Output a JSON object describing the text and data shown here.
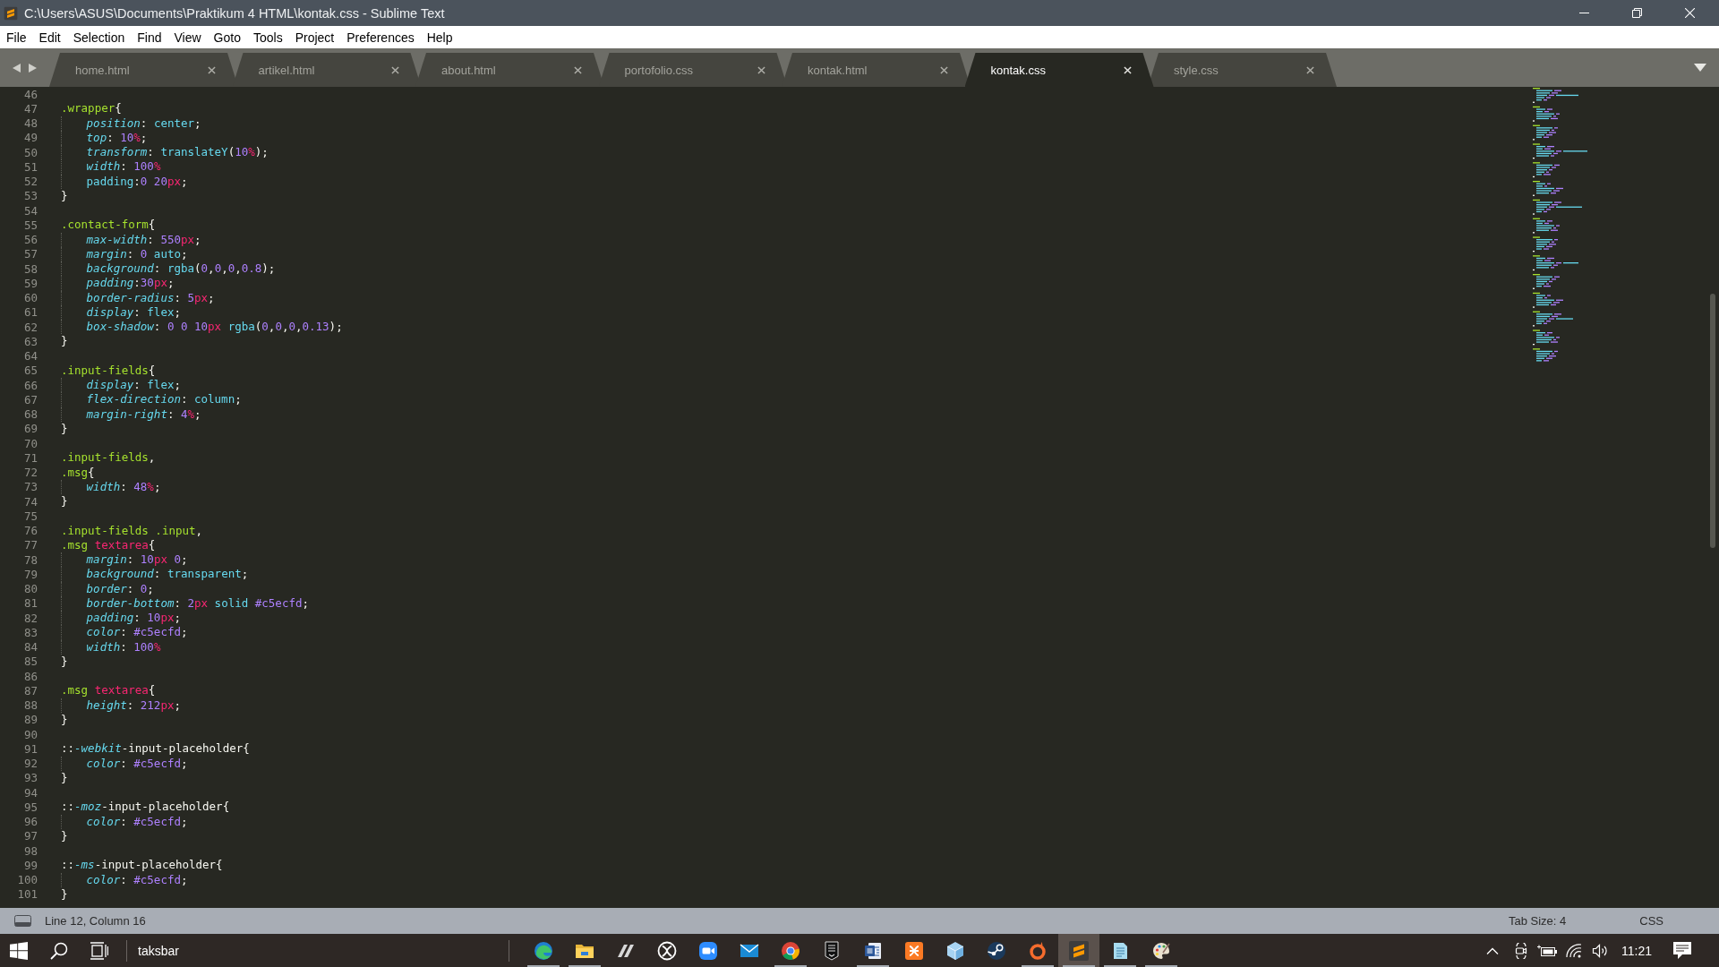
{
  "window": {
    "title": "C:\\Users\\ASUS\\Documents\\Praktikum 4 HTML\\kontak.css - Sublime Text"
  },
  "menu": [
    "File",
    "Edit",
    "Selection",
    "Find",
    "View",
    "Goto",
    "Tools",
    "Project",
    "Preferences",
    "Help"
  ],
  "tabs": [
    {
      "label": "home.html",
      "selected": false
    },
    {
      "label": "artikel.html",
      "selected": false
    },
    {
      "label": "about.html",
      "selected": false
    },
    {
      "label": "portofolio.css",
      "selected": false
    },
    {
      "label": "kontak.html",
      "selected": false
    },
    {
      "label": "kontak.css",
      "selected": true
    },
    {
      "label": "style.css",
      "selected": false
    }
  ],
  "editor": {
    "lines": [
      {
        "number": "46",
        "indented": false
      },
      {
        "number": "47",
        "indented": false,
        "tokens": [
          {
            "text": ".wrapper",
            "kind": "selector"
          },
          {
            "text": "{",
            "kind": "punct"
          }
        ]
      },
      {
        "number": "48",
        "indented": true,
        "tokens": [
          {
            "text": "position",
            "kind": "property"
          },
          {
            "text": ": ",
            "kind": "punct"
          },
          {
            "text": "center",
            "kind": "keyword"
          },
          {
            "text": ";",
            "kind": "punct"
          }
        ]
      },
      {
        "number": "49",
        "indented": true,
        "tokens": [
          {
            "text": "top",
            "kind": "property"
          },
          {
            "text": ": ",
            "kind": "punct"
          },
          {
            "text": "10",
            "kind": "number"
          },
          {
            "text": "%",
            "kind": "unit"
          },
          {
            "text": ";",
            "kind": "punct"
          }
        ]
      },
      {
        "number": "50",
        "indented": true,
        "tokens": [
          {
            "text": "transform",
            "kind": "property"
          },
          {
            "text": ": ",
            "kind": "punct"
          },
          {
            "text": "translateY",
            "kind": "keyword"
          },
          {
            "text": "(",
            "kind": "punct"
          },
          {
            "text": "10",
            "kind": "number"
          },
          {
            "text": "%",
            "kind": "unit"
          },
          {
            "text": ");",
            "kind": "punct"
          }
        ]
      },
      {
        "number": "51",
        "indented": true,
        "tokens": [
          {
            "text": "width",
            "kind": "property"
          },
          {
            "text": ": ",
            "kind": "punct"
          },
          {
            "text": "100",
            "kind": "number"
          },
          {
            "text": "%",
            "kind": "unit"
          }
        ]
      },
      {
        "number": "52",
        "indented": true,
        "tokens": [
          {
            "text": "padding",
            "kind": "keyword"
          },
          {
            "text": ":",
            "kind": "punct"
          },
          {
            "text": "0 20",
            "kind": "number"
          },
          {
            "text": "px",
            "kind": "unit"
          },
          {
            "text": ";",
            "kind": "punct"
          }
        ]
      },
      {
        "number": "53",
        "indented": false,
        "tokens": [
          {
            "text": "}",
            "kind": "punct"
          }
        ]
      },
      {
        "number": "54",
        "indented": false
      },
      {
        "number": "55",
        "indented": false,
        "tokens": [
          {
            "text": ".contact-form",
            "kind": "selector"
          },
          {
            "text": "{",
            "kind": "punct"
          }
        ]
      },
      {
        "number": "56",
        "indented": true,
        "tokens": [
          {
            "text": "max-width",
            "kind": "property"
          },
          {
            "text": ": ",
            "kind": "punct"
          },
          {
            "text": "550",
            "kind": "number"
          },
          {
            "text": "px",
            "kind": "unit"
          },
          {
            "text": ";",
            "kind": "punct"
          }
        ]
      },
      {
        "number": "57",
        "indented": true,
        "tokens": [
          {
            "text": "margin",
            "kind": "property"
          },
          {
            "text": ": ",
            "kind": "punct"
          },
          {
            "text": "0",
            "kind": "number"
          },
          {
            "text": " auto",
            "kind": "keyword"
          },
          {
            "text": ";",
            "kind": "punct"
          }
        ]
      },
      {
        "number": "58",
        "indented": true,
        "tokens": [
          {
            "text": "background",
            "kind": "property"
          },
          {
            "text": ": ",
            "kind": "punct"
          },
          {
            "text": "rgba",
            "kind": "keyword"
          },
          {
            "text": "(",
            "kind": "punct"
          },
          {
            "text": "0",
            "kind": "number"
          },
          {
            "text": ",",
            "kind": "punct"
          },
          {
            "text": "0",
            "kind": "number"
          },
          {
            "text": ",",
            "kind": "punct"
          },
          {
            "text": "0",
            "kind": "number"
          },
          {
            "text": ",",
            "kind": "punct"
          },
          {
            "text": "0.8",
            "kind": "number"
          },
          {
            "text": ");",
            "kind": "punct"
          }
        ]
      },
      {
        "number": "59",
        "indented": true,
        "tokens": [
          {
            "text": "padding",
            "kind": "property"
          },
          {
            "text": ":",
            "kind": "punct"
          },
          {
            "text": "30",
            "kind": "number"
          },
          {
            "text": "px",
            "kind": "unit"
          },
          {
            "text": ";",
            "kind": "punct"
          }
        ]
      },
      {
        "number": "60",
        "indented": true,
        "tokens": [
          {
            "text": "border-radius",
            "kind": "property"
          },
          {
            "text": ": ",
            "kind": "punct"
          },
          {
            "text": "5",
            "kind": "number"
          },
          {
            "text": "px",
            "kind": "unit"
          },
          {
            "text": ";",
            "kind": "punct"
          }
        ]
      },
      {
        "number": "61",
        "indented": true,
        "tokens": [
          {
            "text": "display",
            "kind": "property"
          },
          {
            "text": ": ",
            "kind": "punct"
          },
          {
            "text": "flex",
            "kind": "keyword"
          },
          {
            "text": ";",
            "kind": "punct"
          }
        ]
      },
      {
        "number": "62",
        "indented": true,
        "tokens": [
          {
            "text": "box-shadow",
            "kind": "property"
          },
          {
            "text": ": ",
            "kind": "punct"
          },
          {
            "text": "0 0 10",
            "kind": "number"
          },
          {
            "text": "px",
            "kind": "unit"
          },
          {
            "text": " rgba",
            "kind": "keyword"
          },
          {
            "text": "(",
            "kind": "punct"
          },
          {
            "text": "0",
            "kind": "number"
          },
          {
            "text": ",",
            "kind": "punct"
          },
          {
            "text": "0",
            "kind": "number"
          },
          {
            "text": ",",
            "kind": "punct"
          },
          {
            "text": "0",
            "kind": "number"
          },
          {
            "text": ",",
            "kind": "punct"
          },
          {
            "text": "0.13",
            "kind": "number"
          },
          {
            "text": ");",
            "kind": "punct"
          }
        ]
      },
      {
        "number": "63",
        "indented": false,
        "tokens": [
          {
            "text": "}",
            "kind": "punct"
          }
        ]
      },
      {
        "number": "64",
        "indented": false
      },
      {
        "number": "65",
        "indented": false,
        "tokens": [
          {
            "text": ".input-fields",
            "kind": "selector"
          },
          {
            "text": "{",
            "kind": "punct"
          }
        ]
      },
      {
        "number": "66",
        "indented": true,
        "tokens": [
          {
            "text": "display",
            "kind": "property"
          },
          {
            "text": ": ",
            "kind": "punct"
          },
          {
            "text": "flex",
            "kind": "keyword"
          },
          {
            "text": ";",
            "kind": "punct"
          }
        ]
      },
      {
        "number": "67",
        "indented": true,
        "tokens": [
          {
            "text": "flex-direction",
            "kind": "property"
          },
          {
            "text": ": ",
            "kind": "punct"
          },
          {
            "text": "column",
            "kind": "keyword"
          },
          {
            "text": ";",
            "kind": "punct"
          }
        ]
      },
      {
        "number": "68",
        "indented": true,
        "tokens": [
          {
            "text": "margin-right",
            "kind": "property"
          },
          {
            "text": ": ",
            "kind": "punct"
          },
          {
            "text": "4",
            "kind": "number"
          },
          {
            "text": "%",
            "kind": "unit"
          },
          {
            "text": ";",
            "kind": "punct"
          }
        ]
      },
      {
        "number": "69",
        "indented": false,
        "tokens": [
          {
            "text": "}",
            "kind": "punct"
          }
        ]
      },
      {
        "number": "70",
        "indented": false
      },
      {
        "number": "71",
        "indented": false,
        "tokens": [
          {
            "text": ".input-fields",
            "kind": "selector"
          },
          {
            "text": ",",
            "kind": "punct"
          }
        ]
      },
      {
        "number": "72",
        "indented": false,
        "tokens": [
          {
            "text": ".msg",
            "kind": "selector"
          },
          {
            "text": "{",
            "kind": "punct"
          }
        ]
      },
      {
        "number": "73",
        "indented": true,
        "tokens": [
          {
            "text": "width",
            "kind": "property"
          },
          {
            "text": ": ",
            "kind": "punct"
          },
          {
            "text": "48",
            "kind": "number"
          },
          {
            "text": "%",
            "kind": "unit"
          },
          {
            "text": ";",
            "kind": "punct"
          }
        ]
      },
      {
        "number": "74",
        "indented": false,
        "tokens": [
          {
            "text": "}",
            "kind": "punct"
          }
        ]
      },
      {
        "number": "75",
        "indented": false
      },
      {
        "number": "76",
        "indented": false,
        "tokens": [
          {
            "text": ".input-fields .input",
            "kind": "selector"
          },
          {
            "text": ",",
            "kind": "punct"
          }
        ]
      },
      {
        "number": "77",
        "indented": false,
        "tokens": [
          {
            "text": ".msg",
            "kind": "selector"
          },
          {
            "text": " textarea",
            "kind": "tag"
          },
          {
            "text": "{",
            "kind": "punct"
          }
        ]
      },
      {
        "number": "78",
        "indented": true,
        "tokens": [
          {
            "text": "margin",
            "kind": "property"
          },
          {
            "text": ": ",
            "kind": "punct"
          },
          {
            "text": "10",
            "kind": "number"
          },
          {
            "text": "px",
            "kind": "unit"
          },
          {
            "text": " 0",
            "kind": "number"
          },
          {
            "text": ";",
            "kind": "punct"
          }
        ]
      },
      {
        "number": "79",
        "indented": true,
        "tokens": [
          {
            "text": "background",
            "kind": "property"
          },
          {
            "text": ": ",
            "kind": "punct"
          },
          {
            "text": "transparent",
            "kind": "keyword"
          },
          {
            "text": ";",
            "kind": "punct"
          }
        ]
      },
      {
        "number": "80",
        "indented": true,
        "tokens": [
          {
            "text": "border",
            "kind": "property"
          },
          {
            "text": ": ",
            "kind": "punct"
          },
          {
            "text": "0",
            "kind": "number"
          },
          {
            "text": ";",
            "kind": "punct"
          }
        ]
      },
      {
        "number": "81",
        "indented": true,
        "tokens": [
          {
            "text": "border-bottom",
            "kind": "property"
          },
          {
            "text": ": ",
            "kind": "punct"
          },
          {
            "text": "2",
            "kind": "number"
          },
          {
            "text": "px",
            "kind": "unit"
          },
          {
            "text": " solid",
            "kind": "keyword"
          },
          {
            "text": " #c5ecfd",
            "kind": "number"
          },
          {
            "text": ";",
            "kind": "punct"
          }
        ]
      },
      {
        "number": "82",
        "indented": true,
        "tokens": [
          {
            "text": "padding",
            "kind": "property"
          },
          {
            "text": ": ",
            "kind": "punct"
          },
          {
            "text": "10",
            "kind": "number"
          },
          {
            "text": "px",
            "kind": "unit"
          },
          {
            "text": ";",
            "kind": "punct"
          }
        ]
      },
      {
        "number": "83",
        "indented": true,
        "tokens": [
          {
            "text": "color",
            "kind": "property"
          },
          {
            "text": ": ",
            "kind": "punct"
          },
          {
            "text": "#c5ecfd",
            "kind": "number"
          },
          {
            "text": ";",
            "kind": "punct"
          }
        ]
      },
      {
        "number": "84",
        "indented": true,
        "tokens": [
          {
            "text": "width",
            "kind": "property"
          },
          {
            "text": ": ",
            "kind": "punct"
          },
          {
            "text": "100",
            "kind": "number"
          },
          {
            "text": "%",
            "kind": "unit"
          }
        ]
      },
      {
        "number": "85",
        "indented": false,
        "tokens": [
          {
            "text": "}",
            "kind": "punct"
          }
        ]
      },
      {
        "number": "86",
        "indented": false
      },
      {
        "number": "87",
        "indented": false,
        "tokens": [
          {
            "text": ".msg",
            "kind": "selector"
          },
          {
            "text": " textarea",
            "kind": "tag"
          },
          {
            "text": "{",
            "kind": "punct"
          }
        ]
      },
      {
        "number": "88",
        "indented": true,
        "tokens": [
          {
            "text": "height",
            "kind": "property"
          },
          {
            "text": ": ",
            "kind": "punct"
          },
          {
            "text": "212",
            "kind": "number"
          },
          {
            "text": "px",
            "kind": "unit"
          },
          {
            "text": ";",
            "kind": "punct"
          }
        ]
      },
      {
        "number": "89",
        "indented": false,
        "tokens": [
          {
            "text": "}",
            "kind": "punct"
          }
        ]
      },
      {
        "number": "90",
        "indented": false
      },
      {
        "number": "91",
        "indented": false,
        "tokens": [
          {
            "text": "::",
            "kind": "punct"
          },
          {
            "text": "-webkit",
            "kind": "property"
          },
          {
            "text": "-input-placeholder{",
            "kind": "punct"
          }
        ]
      },
      {
        "number": "92",
        "indented": true,
        "tokens": [
          {
            "text": "color",
            "kind": "property"
          },
          {
            "text": ": ",
            "kind": "punct"
          },
          {
            "text": "#c5ecfd",
            "kind": "number"
          },
          {
            "text": ";",
            "kind": "punct"
          }
        ]
      },
      {
        "number": "93",
        "indented": false,
        "tokens": [
          {
            "text": "}",
            "kind": "punct"
          }
        ]
      },
      {
        "number": "94",
        "indented": false
      },
      {
        "number": "95",
        "indented": false,
        "tokens": [
          {
            "text": "::",
            "kind": "punct"
          },
          {
            "text": "-moz",
            "kind": "property"
          },
          {
            "text": "-input-placeholder{",
            "kind": "punct"
          }
        ]
      },
      {
        "number": "96",
        "indented": true,
        "tokens": [
          {
            "text": "color",
            "kind": "property"
          },
          {
            "text": ": ",
            "kind": "punct"
          },
          {
            "text": "#c5ecfd",
            "kind": "number"
          },
          {
            "text": ";",
            "kind": "punct"
          }
        ]
      },
      {
        "number": "97",
        "indented": false,
        "tokens": [
          {
            "text": "}",
            "kind": "punct"
          }
        ]
      },
      {
        "number": "98",
        "indented": false
      },
      {
        "number": "99",
        "indented": false,
        "tokens": [
          {
            "text": "::",
            "kind": "punct"
          },
          {
            "text": "-ms",
            "kind": "property"
          },
          {
            "text": "-input-placeholder{",
            "kind": "punct"
          }
        ]
      },
      {
        "number": "100",
        "indented": true,
        "tokens": [
          {
            "text": "color",
            "kind": "property"
          },
          {
            "text": ": ",
            "kind": "punct"
          },
          {
            "text": "#c5ecfd",
            "kind": "number"
          },
          {
            "text": ";",
            "kind": "punct"
          }
        ]
      },
      {
        "number": "101",
        "indented": false,
        "tokens": [
          {
            "text": "}",
            "kind": "punct"
          }
        ]
      }
    ]
  },
  "status_bar": {
    "position": "Line 12, Column 16",
    "tab_size": "Tab Size: 4",
    "syntax": "CSS"
  },
  "taskbar": {
    "toolbar_label": "taksbar",
    "apps": [
      {
        "kind": "swirl",
        "running": true,
        "selected": false
      },
      {
        "kind": "folder",
        "running": true,
        "selected": false
      },
      {
        "kind": "slashes",
        "running": false,
        "selected": false
      },
      {
        "kind": "xcircle",
        "running": false,
        "selected": false
      },
      {
        "kind": "camera",
        "running": false,
        "selected": false
      },
      {
        "kind": "envelope",
        "running": false,
        "selected": false
      },
      {
        "kind": "tricolor",
        "running": true,
        "selected": false
      },
      {
        "kind": "shield",
        "running": false,
        "selected": false
      },
      {
        "kind": "document",
        "running": true,
        "selected": false
      },
      {
        "kind": "knot",
        "running": false,
        "selected": false
      },
      {
        "kind": "cube",
        "running": false,
        "selected": false
      },
      {
        "kind": "linkage",
        "running": false,
        "selected": false
      },
      {
        "kind": "ring",
        "running": true,
        "selected": false
      },
      {
        "kind": "logo",
        "running": true,
        "selected": true
      },
      {
        "kind": "notepad",
        "running": true,
        "selected": false
      },
      {
        "kind": "palette",
        "running": true,
        "selected": false
      }
    ],
    "clock": "11:21"
  }
}
